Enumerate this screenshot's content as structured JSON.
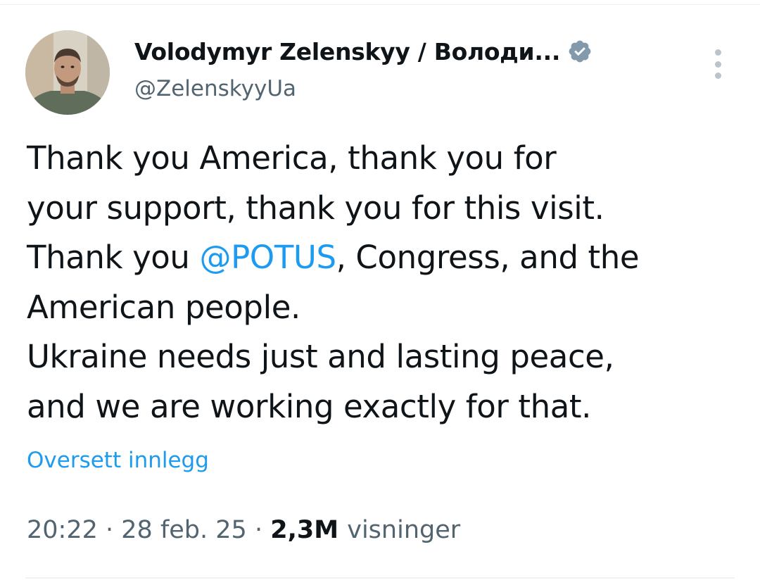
{
  "author": {
    "display_name": "Volodymyr Zelenskyy / Володи...",
    "handle": "@ZelenskyyUa",
    "avatar_icon": "profile-photo",
    "verified_icon": "verified-badge-icon",
    "verified_color": "#829aab"
  },
  "tweet": {
    "lines": [
      [
        {
          "text": "Thank you America, thank you for"
        }
      ],
      [
        {
          "text": "your support, thank you for this visit."
        }
      ],
      [
        {
          "text": "Thank you "
        },
        {
          "text": "@POTUS",
          "mention": true
        },
        {
          "text": ", Congress, and the"
        }
      ],
      [
        {
          "text": "American people."
        }
      ],
      [
        {
          "text": "Ukraine needs just and lasting peace,"
        }
      ],
      [
        {
          "text": "and we are working exactly for that."
        }
      ]
    ]
  },
  "translate_label": "Oversett innlegg",
  "meta": {
    "time": "20:22",
    "separator": "·",
    "date": "28 feb. 25",
    "views_count": "2,3M",
    "views_label": "visninger"
  },
  "colors": {
    "link": "#1d9bf0",
    "secondary_text": "#536471",
    "primary_text": "#0f1419"
  }
}
